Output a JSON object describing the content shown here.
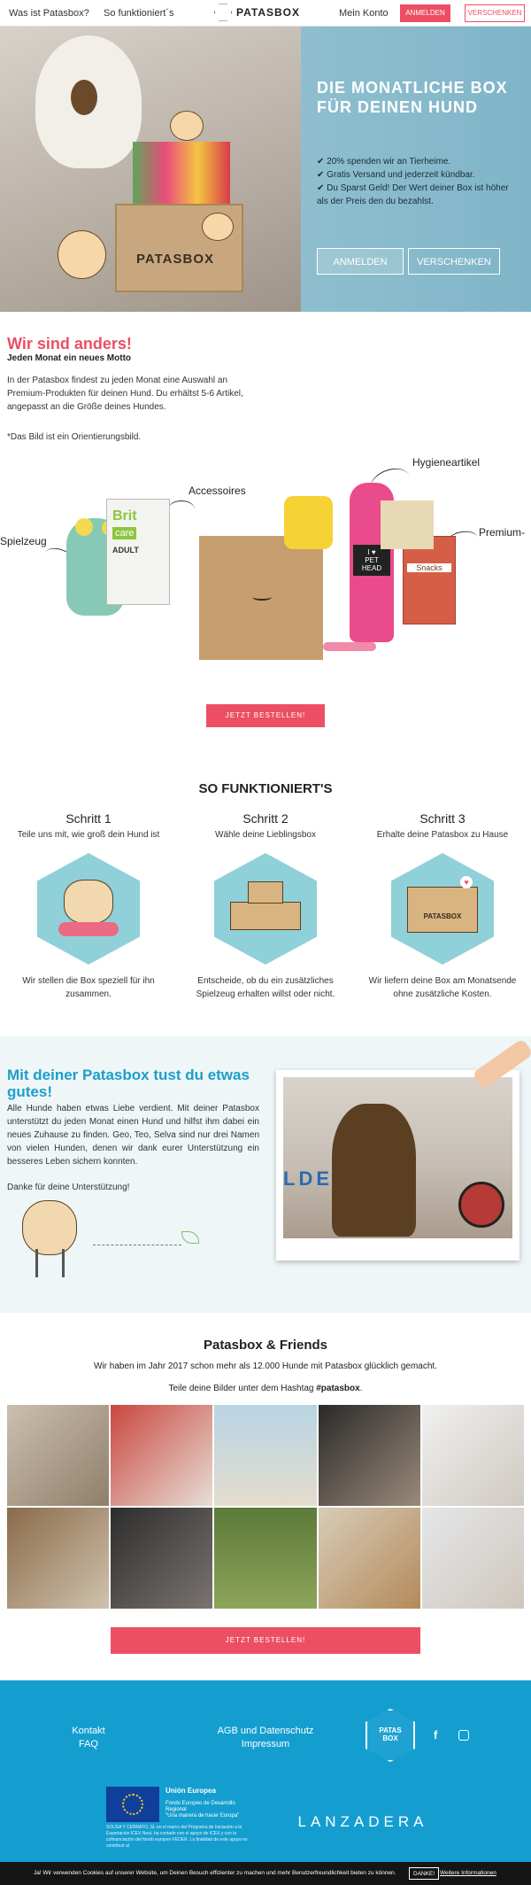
{
  "nav": {
    "what": "Was ist Patasbox?",
    "how": "So funktioniert´s",
    "logo": "PATASBOX",
    "account": "Mein Konto",
    "signup": "ANMELDEN",
    "gift": "VERSCHENKEN"
  },
  "hero": {
    "box_text": "PATASBOX",
    "title_1": "DIE MONATLICHE BOX",
    "title_2": "FÜR DEINEN HUND",
    "bullets": [
      "20% spenden wir an Tierheime.",
      "Gratis Versand und jederzeit kündbar.",
      "Du Sparst Geld! Der Wert deiner Box ist höher als der Preis den du bezahlst."
    ],
    "signup": "ANMELDEN",
    "gift": "VERSCHENKEN"
  },
  "different": {
    "title": "Wir sind anders!",
    "subtitle": "Jeden Monat ein neues Motto",
    "text": "In der Patasbox findest zu jeden Monat eine Auswahl an Premium-Produkten für deinen Hund. Du erhältst 5-6 Artikel, angepasst an die Größe deines Hundes.",
    "note": "*Das Bild ist ein Orientierungsbild."
  },
  "products": {
    "hygiene": "Hygieneartikel",
    "accessories": "Accessoires",
    "toys": "Spielzeug",
    "premium": "Premium-",
    "brand1": "Brit",
    "brand1b": "care",
    "adult": "ADULT",
    "pethead1": "I ♥",
    "pethead2": "PET",
    "pethead3": "HEAD",
    "snacks": "Snacks"
  },
  "order_button": "JETZT BESTELLEN!",
  "how": {
    "title": "SO FUNKTIONIERT'S",
    "steps": [
      {
        "title": "Schritt 1",
        "sub": "Teile uns mit, wie groß dein Hund ist",
        "desc": "Wir stellen die Box speziell für ihn zusammen."
      },
      {
        "title": "Schritt 2",
        "sub": "Wähle deine Lieblingsbox",
        "desc": "Entscheide, ob du ein zusätzliches Spielzeug erhalten willst oder nicht."
      },
      {
        "title": "Schritt 3",
        "sub": "Erhalte deine Patasbox zu Hause",
        "desc": "Wir liefern deine Box am Monatsende ohne zusätzliche Kosten."
      }
    ],
    "step3_box": "PATASBOX"
  },
  "charity": {
    "title": "Mit deiner Patasbox tust du etwas gutes!",
    "text": "Alle Hunde haben etwas Liebe verdient. Mit deiner Patasbox unterstützt du jeden Monat einen Hund und hilfst ihm dabei ein neues Zuhause zu finden. Geo, Teo, Selva sind nur drei Namen von vielen Hunden, denen wir dank eurer Unterstützung ein besseres Leben sichern konnten.",
    "thanks": "Danke für deine Unterstützung!",
    "photo_text": "LDENA"
  },
  "friends": {
    "title": "Patasbox & Friends",
    "line1": "Wir haben im Jahr 2017 schon mehr als 12.000 Hunde mit Patasbox glücklich gemacht.",
    "line2_pre": "Teile deine Bilder unter dem Hashtag ",
    "hashtag": "#patasbox",
    "line2_post": ".",
    "order": "JETZT BESTELLEN!"
  },
  "footer": {
    "contact": "Kontakt",
    "faq": "FAQ",
    "agb": "AGB und Datenschutz",
    "imprint": "Impressum",
    "logo1": "PATAS",
    "logo2": "BOX",
    "eu_title": "Unión Europea",
    "eu_fund": "Fondo Europeo de Desarrollo Regional",
    "eu_motto": "\"Una manera de hacer Europa\"",
    "eu_small": "SOUSA Y CEBRATO, SL en el marco del Programa de Iniciación a la Exportación ICEX Next, ha contado con el apoyo de ICEX y con la cofinanciación del fondo europeo FEDER. La finalidad de este apoyo es contribuir al",
    "lanzadera": "LANZADERA"
  },
  "cookie": {
    "text": "Ja! Wir verwenden Cookies auf unserer Website, um Deinen Besuch effizienter zu machen und mehr Benutzerfreundlichkeit bieten zu können.",
    "ok": "DANKE!",
    "more": "Weitere Informationen"
  },
  "colors": {
    "accent": "#ec4f64",
    "blue": "#149ed0",
    "teal": "#8fd0d9"
  }
}
